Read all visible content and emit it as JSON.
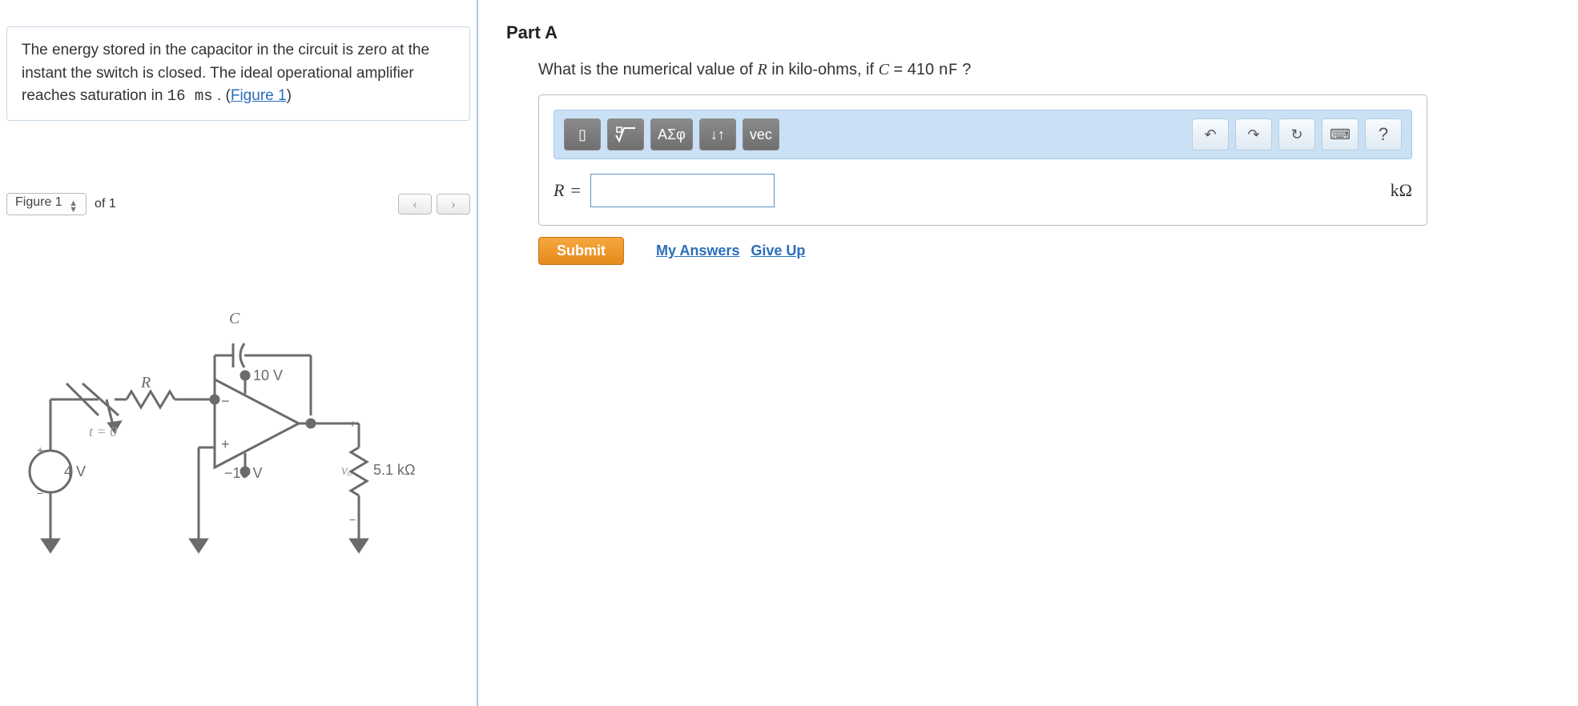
{
  "problem": {
    "text_prefix": "The energy stored in the capacitor in the circuit is zero at the instant the switch is closed. The ideal operational amplifier reaches saturation in ",
    "time_value": "16 ms",
    "text_suffix": " . (",
    "figure_link_text": "Figure 1",
    "text_end": ")"
  },
  "figure_nav": {
    "label": "Figure 1",
    "of_text": "of 1",
    "prev": "‹",
    "next": "›"
  },
  "circuit": {
    "label_C": "C",
    "label_R": "R",
    "label_t0": "t = 0",
    "label_src": "4 V",
    "label_vp": "10 V",
    "label_vn": "−10 V",
    "label_vo": "vₒ",
    "label_load": "5.1 kΩ"
  },
  "part": {
    "title": "Part A",
    "question_prefix": "What is the numerical value of ",
    "var_R": "R",
    "question_mid": " in kilo-ohms, if ",
    "var_C": "C",
    "question_eq": " = 410 ",
    "unit_nF": "nF",
    "question_end": " ?"
  },
  "toolbar": {
    "template": "▯",
    "root": "√",
    "greek": "ΑΣφ",
    "subsup": "↓↑",
    "vec": "vec",
    "undo": "↶",
    "redo": "↷",
    "reset": "↻",
    "keyboard": "⌨",
    "help": "?"
  },
  "answer": {
    "lhs": "R",
    "eq": "=",
    "value": "",
    "unit": "kΩ"
  },
  "actions": {
    "submit": "Submit",
    "my_answers": "My Answers",
    "give_up": "Give Up"
  }
}
